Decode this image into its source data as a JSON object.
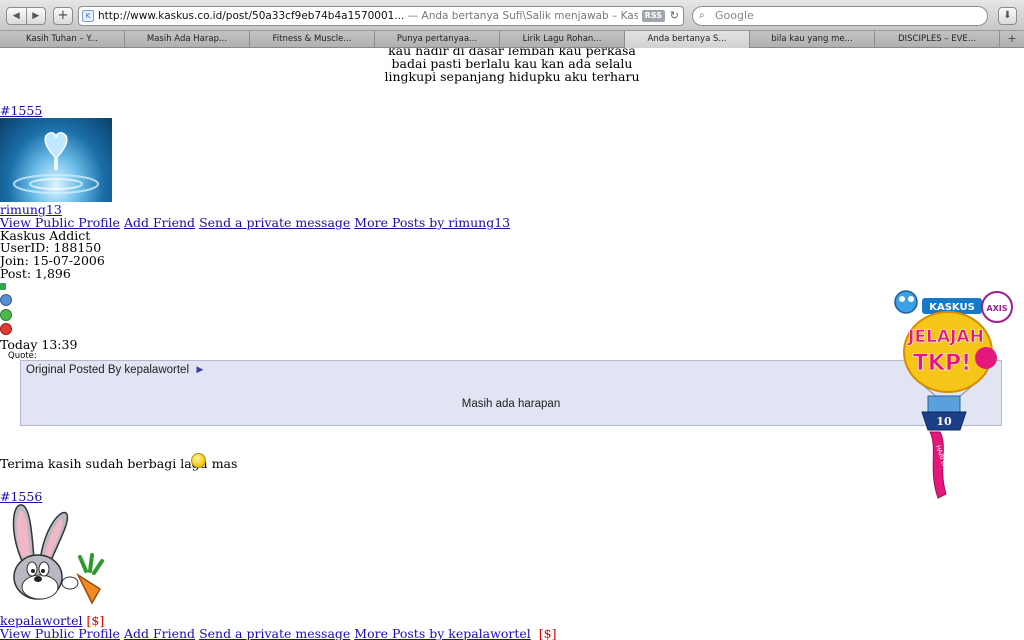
{
  "browser": {
    "url": "http://www.kaskus.co.id/post/50a33cf9eb74b4a1570001...",
    "page_title": " — Anda bertanya Sufi\\Salik menjawab – Kaskus – The Lar...",
    "rss_label": "RSS",
    "search_placeholder": "Google",
    "back_icon": "back-arrow-icon",
    "forward_icon": "forward-arrow-icon",
    "add_icon": "plus-icon",
    "reload_icon": "reload-icon",
    "downloads_icon": "download-icon",
    "tabs": [
      {
        "label": "Kasih Tuhan – Y..."
      },
      {
        "label": "Masih Ada Harap..."
      },
      {
        "label": "Fitness & Muscle..."
      },
      {
        "label": "Punya pertanyaa..."
      },
      {
        "label": "Lirik Lagu Rohan..."
      },
      {
        "label": "Anda bertanya S..."
      },
      {
        "label": "bila kau yang me..."
      },
      {
        "label": "DISCIPLES – EVE..."
      }
    ],
    "tab_add_label": "+"
  },
  "lyrics": [
    "kau hadir di dasar lembah kau perkasa",
    "badai pasti berlalu kau kan ada selalu",
    "lingkupi sepanjang hidupku aku terharu"
  ],
  "post1": {
    "number": "#1555",
    "username": "rimung13",
    "links": [
      "View Public Profile",
      "Add Friend",
      "Send a private message",
      "More Posts by rimung13"
    ],
    "rank": "Kaskus Addict",
    "userid": "UserID: 188150",
    "join": "Join: 15-07-2006",
    "posts": "Post: 1,896",
    "time": "Today 13:39",
    "quote_label": "Quote:",
    "quote_by": "Original Posted By kepalawortel",
    "quote_arrow": "►",
    "quote_text": "Masih ada harapan",
    "message": "Terima kasih sudah berbagi lagu mas"
  },
  "post2": {
    "number": "#1556",
    "username": "kepalawortel",
    "money_tag": "[$]",
    "links": [
      "View Public Profile",
      "Add Friend",
      "Send a private message",
      "More Posts by kepalawortel"
    ]
  },
  "badge": {
    "brand": "KASKUS",
    "partner": "AXIS",
    "line1": "JELAJAH",
    "line2": "TKP!",
    "count": "10",
    "ribbon": "HARI LAGI"
  },
  "colors": {
    "link": "#1a0dab",
    "quote_bg": "#e1e4f2",
    "money": "#dd0000",
    "badge_pink": "#e5177d",
    "badge_yellow": "#f5c518"
  }
}
